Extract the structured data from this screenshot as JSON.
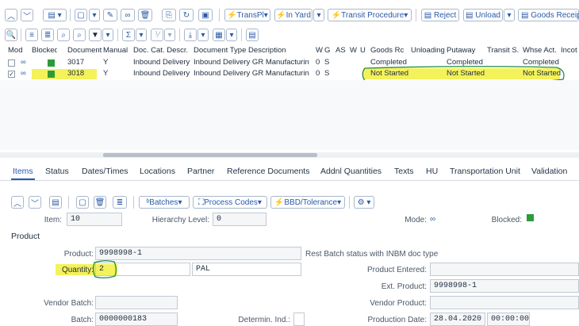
{
  "toolbar1": {
    "transport_planning": "TransPl",
    "in_yard": "In Yard",
    "transit_procedure": "Transit Procedure",
    "reject": "Reject",
    "unload": "Unload",
    "goods_receipt": "Goods Receipt"
  },
  "grid": {
    "headers": [
      "Mod",
      "Blocked",
      "Document",
      "Manual",
      "Doc. Cat. Descr.",
      "Document Type Description",
      "W",
      "G",
      "AS",
      "W",
      "U",
      "Goods Rc",
      "Unloading",
      "Putaway",
      "Transit S.",
      "Whse Act.",
      "Incot"
    ],
    "rows": [
      {
        "document": "3017",
        "manual": "Y",
        "cat": "Inbound Delivery",
        "type": "Inbound Delivery GR Manufacturin",
        "w": "0",
        "g": "S",
        "goods_receipt": "Completed",
        "putaway": "Completed",
        "whse_act": "Completed"
      },
      {
        "document": "3018",
        "manual": "Y",
        "cat": "Inbound Delivery",
        "type": "Inbound Delivery GR Manufacturin",
        "w": "0",
        "g": "S",
        "goods_receipt": "Not Started",
        "putaway": "Not Started",
        "whse_act": "Not Started"
      }
    ]
  },
  "tabs": [
    "Items",
    "Status",
    "Dates/Times",
    "Locations",
    "Partner",
    "Reference Documents",
    "Addnl Quantities",
    "Texts",
    "HU",
    "Transportation Unit",
    "Validation"
  ],
  "toolbar2": {
    "batches": "Batches",
    "process_codes": "Process Codes",
    "bbd_tolerance": "BBD/Tolerance"
  },
  "item": {
    "item_label": "Item:",
    "item_value": "10",
    "hierarchy_label": "Hierarchy Level:",
    "hierarchy_value": "0",
    "mode_label": "Mode:",
    "blocked_label": "Blocked:"
  },
  "product_section": {
    "title": "Product",
    "product_label": "Product:",
    "product_value": "9998998-1",
    "rest_batch_text": "Rest Batch status with INBM doc type",
    "quantity_label": "Quantity:",
    "quantity_value": "2",
    "uom": "PAL",
    "product_entered_label": "Product Entered:",
    "product_entered_value": "",
    "ext_product_label": "Ext. Product:",
    "ext_product_value": "9998998-1",
    "vendor_batch_label": "Vendor Batch:",
    "vendor_batch_value": "",
    "vendor_product_label": "Vendor Product:",
    "vendor_product_value": "",
    "batch_label": "Batch:",
    "batch_value": "0000000183",
    "determin_label": "Determin. Ind.:",
    "production_date_label": "Production Date:",
    "production_date_value": "28.04.2020",
    "production_time_value": "00:00:00"
  },
  "colors": {
    "highlight": "#f4f25a",
    "annotation_green": "#1e8a4a",
    "blocked_green": "#2e9a3a",
    "selected_row": "#dce9f7"
  }
}
